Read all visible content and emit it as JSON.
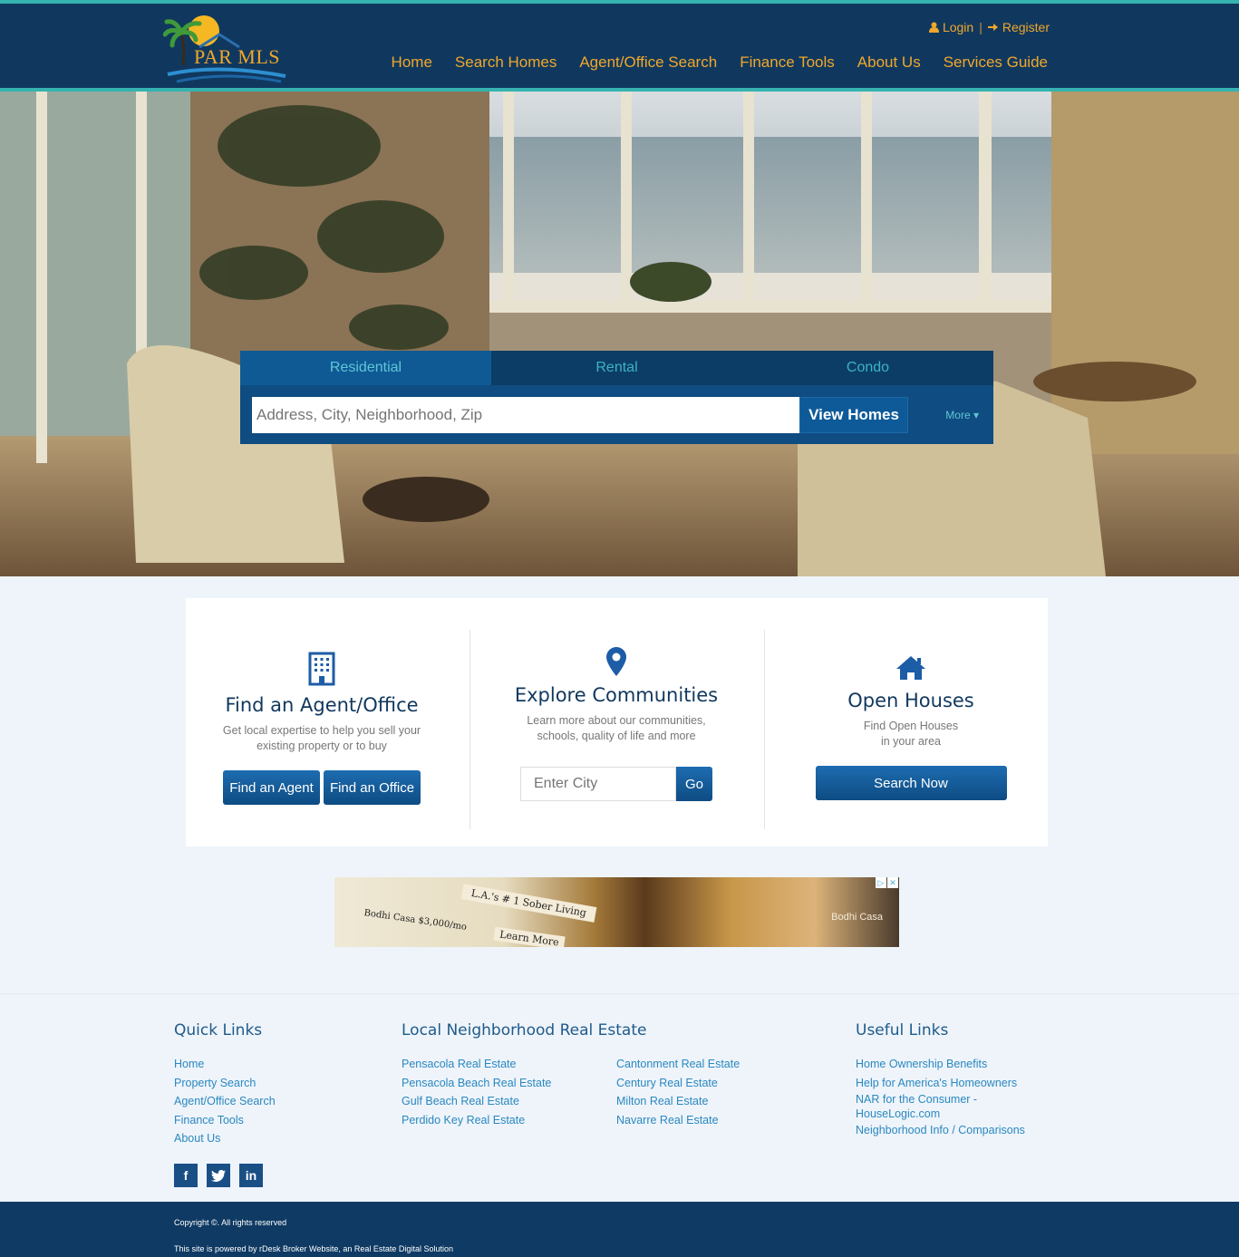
{
  "brand": {
    "logo_text": "PAR MLS"
  },
  "header": {
    "login_label": "Login",
    "register_label": "Register",
    "nav": [
      "Home",
      "Search Homes",
      "Agent/Office Search",
      "Finance Tools",
      "About Us",
      "Services Guide"
    ]
  },
  "search": {
    "tabs": [
      "Residential",
      "Rental",
      "Condo"
    ],
    "active_tab": "Residential",
    "placeholder": "Address, City, Neighborhood, Zip",
    "button": "View Homes",
    "more": "More"
  },
  "features": {
    "agent": {
      "title": "Find an Agent/Office",
      "desc1": "Get local expertise to help you sell your",
      "desc2": "existing property or to buy",
      "btn_agent": "Find an Agent",
      "btn_office": "Find an Office",
      "icon": "building-icon"
    },
    "communities": {
      "title": "Explore Communities",
      "desc1": "Learn more about our communities,",
      "desc2": "schools, quality of life and more",
      "placeholder": "Enter City",
      "btn": "Go",
      "icon": "map-pin-icon"
    },
    "open_houses": {
      "title": "Open Houses",
      "desc1": "Find Open Houses",
      "desc2": "in your area",
      "btn": "Search Now",
      "icon": "home-icon"
    }
  },
  "ad": {
    "headline": "L.A.'s # 1 Sober Living",
    "price": "Bodhi Casa $3,000/mo",
    "cta": "Learn More",
    "brand": "Bodhi Casa"
  },
  "footer": {
    "quick_links": {
      "title": "Quick Links",
      "items": [
        "Home",
        "Property Search",
        "Agent/Office Search",
        "Finance Tools",
        "About Us"
      ]
    },
    "local": {
      "title": "Local Neighborhood Real Estate",
      "col1": [
        "Pensacola Real Estate",
        "Pensacola Beach Real Estate",
        "Gulf Beach Real Estate",
        "Perdido Key Real Estate"
      ],
      "col2": [
        "Cantonment Real Estate",
        "Century Real Estate",
        "Milton Real Estate",
        "Navarre Real Estate"
      ]
    },
    "useful": {
      "title": "Useful Links",
      "items": [
        "Home Ownership Benefits",
        "Help for America's Homeowners",
        "NAR for the Consumer -",
        "HouseLogic.com",
        "Neighborhood Info / Comparisons"
      ]
    },
    "social": [
      "f",
      "t",
      "in"
    ],
    "copyright": "Copyright ©. All rights reserved",
    "powered": "This site is powered by rDesk Broker Website, an Real Estate Digital Solution"
  },
  "colors": {
    "navy": "#10385e",
    "teal": "#35b3b0",
    "orange": "#f0a72c",
    "link": "#2a88c0"
  }
}
